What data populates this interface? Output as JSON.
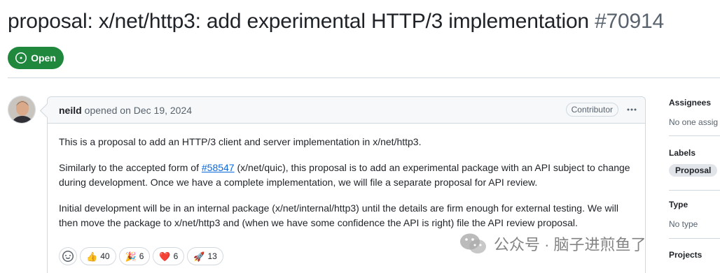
{
  "issue": {
    "title": "proposal: x/net/http3: add experimental HTTP/3 implementation",
    "number": "#70914",
    "state": "Open",
    "state_color": "#1f883d"
  },
  "comment": {
    "author": "neild",
    "meta": "opened on Dec 19, 2024",
    "role_badge": "Contributor",
    "body": {
      "p1": "This is a proposal to add an HTTP/3 client and server implementation in x/net/http3.",
      "p2_before": "Similarly to the accepted form of ",
      "p2_link": "#58547",
      "p2_after": " (x/net/quic), this proposal is to add an experimental package with an API subject to change during development. Once we have a complete implementation, we will file a separate proposal for API review.",
      "p3": "Initial development will be in an internal package (x/net/internal/http3) until the details are firm enough for external testing. We will then move the package to x/net/http3 and (when we have some confidence the API is right) file the API review proposal."
    },
    "reactions": [
      {
        "emoji": "👍",
        "icon": "thumbs-up-icon",
        "count": "40"
      },
      {
        "emoji": "🎉",
        "icon": "party-popper-icon",
        "count": "6"
      },
      {
        "emoji": "❤️",
        "icon": "heart-icon",
        "count": "6"
      },
      {
        "emoji": "🚀",
        "icon": "rocket-icon",
        "count": "13"
      }
    ]
  },
  "sidebar": {
    "assignees_label": "Assignees",
    "assignees_value": "No one assig",
    "labels_label": "Labels",
    "label_pill": "Proposal",
    "type_label": "Type",
    "type_value": "No type",
    "projects_label": "Projects"
  },
  "watermark": {
    "text": "公众号 · 脑子进煎鱼了"
  },
  "colors": {
    "link": "#0969da",
    "border": "#d1d9e0",
    "muted": "#59636e"
  }
}
